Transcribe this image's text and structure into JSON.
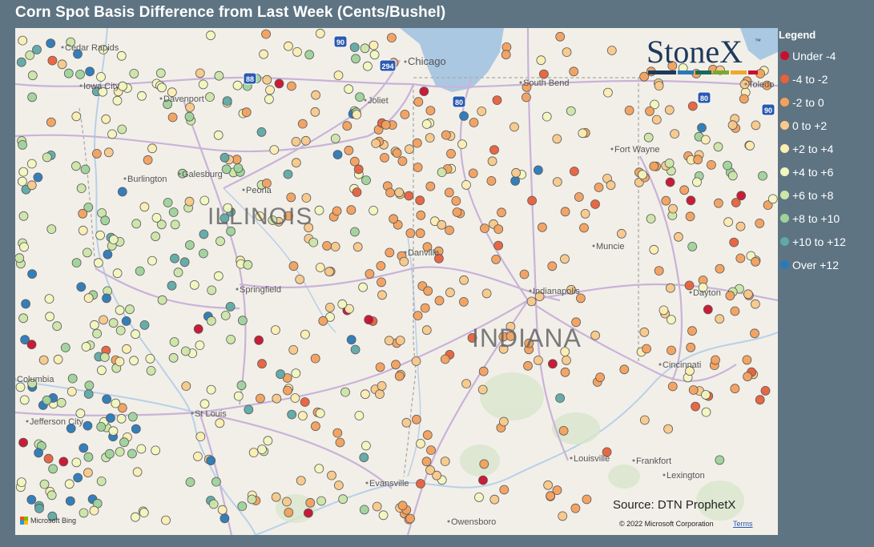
{
  "title": "Corn Spot Basis Difference from Last Week (Cents/Bushel)",
  "legend": {
    "title": "Legend",
    "items": [
      {
        "label": "Under -4",
        "color": "#c8102e"
      },
      {
        "label": "-4 to -2",
        "color": "#e8603c"
      },
      {
        "label": "-2 to 0",
        "color": "#f4a15d"
      },
      {
        "label": "0 to +2",
        "color": "#f8c98a"
      },
      {
        "label": "+2 to +4",
        "color": "#fbeeb3"
      },
      {
        "label": "+4 to +6",
        "color": "#f3f7bf"
      },
      {
        "label": "+6 to +8",
        "color": "#cde6a8"
      },
      {
        "label": "+8 to +10",
        "color": "#9fd39a"
      },
      {
        "label": "+10 to +12",
        "color": "#5fa9a6"
      },
      {
        "label": "Over +12",
        "color": "#2a7ab8"
      }
    ]
  },
  "logo": {
    "text": "StoneX",
    "tm": "™"
  },
  "source": "Source: DTN ProphetX",
  "copyright": "© 2022 Microsoft Corporation",
  "terms": "Terms",
  "bing": "Microsoft Bing",
  "states": [
    "ILLINOIS",
    "INDIANA"
  ],
  "cities": [
    "Cedar Rapids",
    "Iowa City",
    "Davenport",
    "Galesburg",
    "Burlington",
    "Peoria",
    "Joliet",
    "Chicago",
    "South Bend",
    "Toledo",
    "Fort Wayne",
    "Danville",
    "Muncie",
    "Indianapolis",
    "Dayton",
    "Springfield",
    "Columbia",
    "Jefferson City",
    "St Louis",
    "Cincinnati",
    "Louisville",
    "Frankfort",
    "Lexington",
    "Evansville",
    "Owensboro"
  ],
  "highways": [
    "90",
    "294",
    "80",
    "88",
    "80",
    "90"
  ],
  "colors": {
    "background": "#5e7483",
    "map": "#f2efe9",
    "road": "#c9b3d8",
    "water": "#abc8e2"
  }
}
